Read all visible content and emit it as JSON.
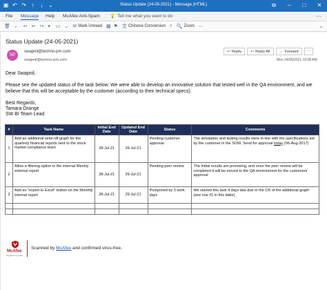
{
  "window": {
    "title": "Status Update (24-05-2021) - Message (HTML)",
    "controls": [
      "restore-icon",
      "minimize-icon",
      "maximize-icon",
      "close-icon"
    ]
  },
  "menu": {
    "tabs": [
      "File",
      "Message",
      "Help",
      "McAfee Anti-Spam"
    ],
    "active": "Message",
    "tell_me": "Tell me what you want to do"
  },
  "toolbar": {
    "items": [
      "Mark Unread",
      "Chinese Conversion",
      "Zoom"
    ]
  },
  "message": {
    "subject": "Status Update (24-05-2021)",
    "avatar_initials": "SP",
    "avatar_color": "#d04fb3",
    "from": "swapnil@techno-pm.com",
    "to": "swapnil@techno-pm.com",
    "actions": {
      "reply": "Reply",
      "reply_all": "Reply All",
      "forward": "Forward"
    },
    "date": "Mon 24/05/2021 10:08 AM"
  },
  "body": {
    "greeting": "Dear Swapnil,",
    "paragraph": "Please see the updated status of the task below. We were able to develop an innovative solution that tested well in the QA environment, and we believe that this will be acceptable by the customer (according to their technical specs).",
    "regards": "Best Regards,",
    "name": "Tamara Orange",
    "role": "SW BI Team Lead"
  },
  "table": {
    "header_color": "#1f2f5a",
    "headers": [
      "#",
      "Task Name",
      "Initial End Date",
      "Updated End Date",
      "Status",
      "Comments"
    ],
    "rows": [
      {
        "num": "1",
        "task": "Add an additional write-off graph for the quarterly financial reports sent to the stock market compliance team",
        "initial": "28-Jul-21",
        "updated": "29-Jul-21",
        "status": "Pending customer approval",
        "comments_main": "The simulation and testing results were in-line with the specifications set by the customer in the SOW. Send for approval ",
        "comments_link": "today",
        "comments_tail": " (06-Aug-2017)"
      },
      {
        "num": "2",
        "task": "Allow a filtering option in the internal Weekly external report",
        "initial": "28-Jul-21",
        "updated": "29-Jul-21",
        "status": "Pending peer review",
        "comments": "The Initial results are promising, and once the peer review will be completed it will be moved to the QA environment for the customers' approval"
      },
      {
        "num": "3",
        "task": "Add an \"export to Excel\" button on the Monthly internal report",
        "initial": "28-Jul-21",
        "updated": "29-Jul-21",
        "status": "Postponed by 3 work days",
        "comments": "We started this task 4 days late due to the CR of the additional graph (see row #1 in this table)"
      }
    ]
  },
  "footer": {
    "brand": "McAfee",
    "tagline": "Together is power.",
    "text_before": "Scanned by ",
    "link": "McAfee",
    "text_after": " and confirmed virus-free."
  }
}
